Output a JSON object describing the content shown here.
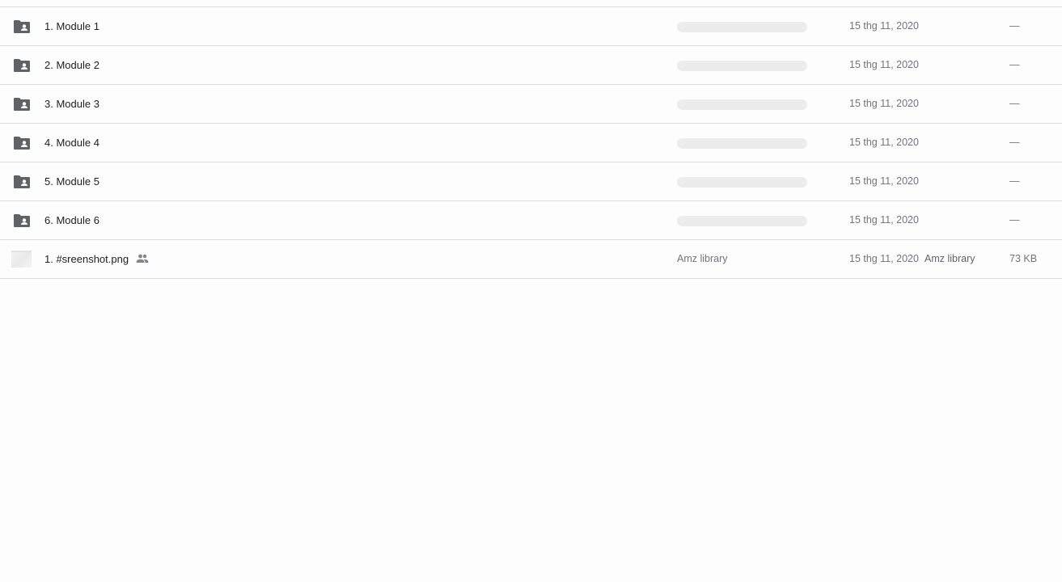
{
  "files": [
    {
      "name": "1. Module 1",
      "modified": "15 thg 11, 2020",
      "size": "—"
    },
    {
      "name": "2. Module 2",
      "modified": "15 thg 11, 2020",
      "size": "—"
    },
    {
      "name": "3. Module 3",
      "modified": "15 thg 11, 2020",
      "size": "—"
    },
    {
      "name": "4. Module 4",
      "modified": "15 thg 11, 2020",
      "size": "—"
    },
    {
      "name": "5. Module 5",
      "modified": "15 thg 11, 2020",
      "size": "—"
    },
    {
      "name": "6. Module 6",
      "modified": "15 thg 11, 2020",
      "size": "—"
    },
    {
      "name": "1. #sreenshot.png",
      "owner": "Amz library",
      "modified": "15 thg 11, 2020",
      "modified_by": "Amz library",
      "size": "73 KB"
    }
  ],
  "icons": {
    "folder": "shared-folder-icon",
    "image": "image-thumbnail",
    "shared": "people-icon"
  },
  "colors": {
    "icon": "#5f6368",
    "divider": "#dadce0",
    "placeholder": "#ececec"
  }
}
